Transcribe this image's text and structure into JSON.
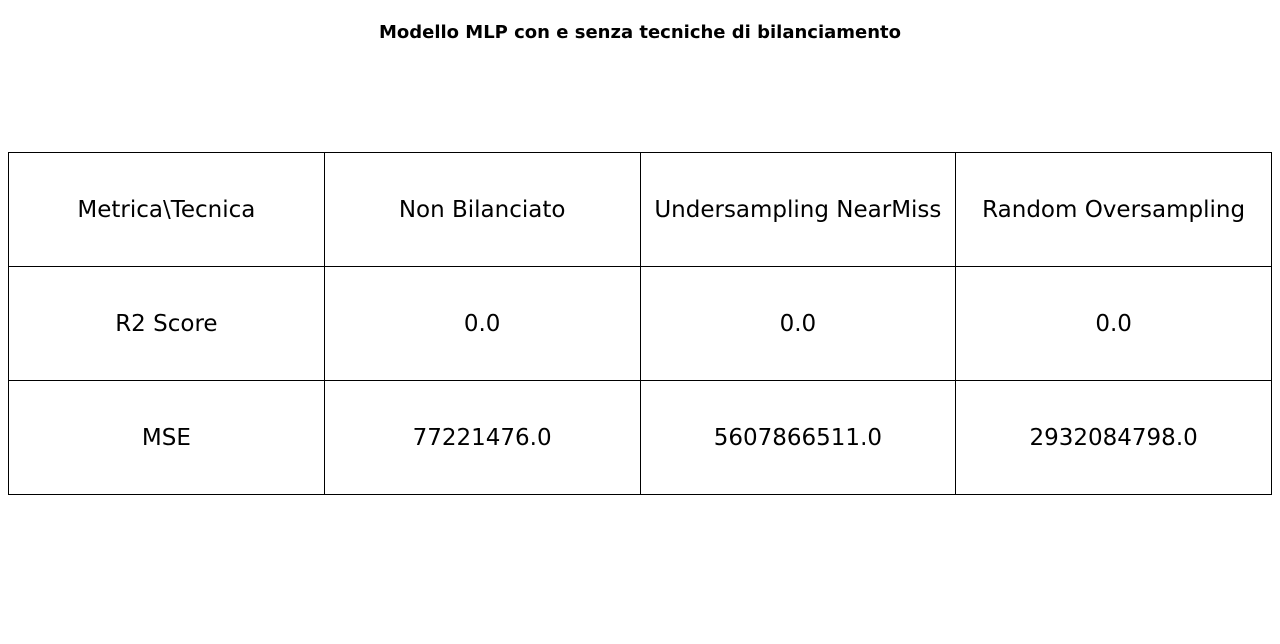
{
  "chart_data": {
    "type": "table",
    "title": "Modello MLP con e senza tecniche di bilanciamento",
    "columns": [
      "Metrica\\Tecnica",
      "Non Bilanciato",
      "Undersampling NearMiss",
      "Random Oversampling"
    ],
    "rows": [
      [
        "R2 Score",
        "0.0",
        "0.0",
        "0.0"
      ],
      [
        "MSE",
        "77221476.0",
        "5607866511.0",
        "2932084798.0"
      ]
    ]
  }
}
